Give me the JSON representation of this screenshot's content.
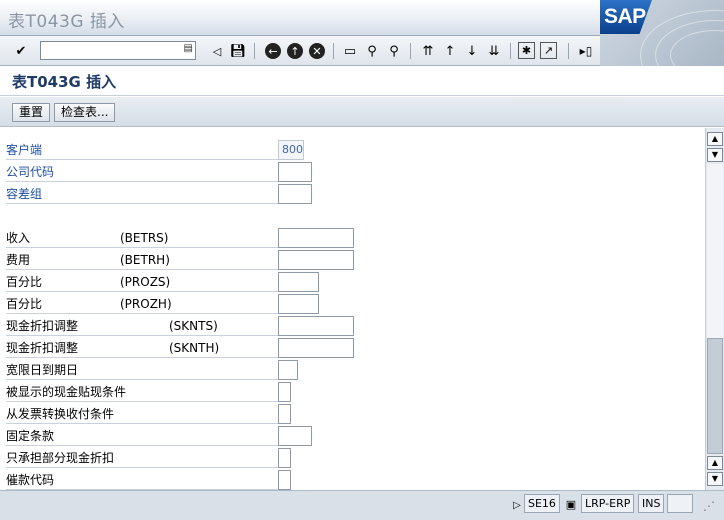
{
  "window": {
    "title": "表T043G 插入"
  },
  "logo_text": "SAP",
  "toolbar": {
    "command_field_value": "",
    "icons": [
      "enter-icon",
      "save-icon",
      "back-icon",
      "exit-icon",
      "cancel-icon",
      "print-icon",
      "find-icon",
      "find-next-icon",
      "first-page-icon",
      "prev-page-icon",
      "next-page-icon",
      "last-page-icon",
      "new-session-icon",
      "shortcut-icon",
      "help-icon"
    ]
  },
  "screen_title": "表T043G 插入",
  "app_toolbar": {
    "buttons": [
      "重置",
      "检查表..."
    ]
  },
  "fields": [
    {
      "label": "客户端",
      "tech": "",
      "value": "800"
    },
    {
      "label": "公司代码",
      "tech": "",
      "value": ""
    },
    {
      "label": "容差组",
      "tech": "",
      "value": ""
    },
    {
      "label": "收入",
      "tech": "(BETRS)",
      "value": ""
    },
    {
      "label": "费用",
      "tech": "(BETRH)",
      "value": ""
    },
    {
      "label": "百分比",
      "tech": "(PROZS)",
      "value": ""
    },
    {
      "label": "百分比",
      "tech": "(PROZH)",
      "value": ""
    },
    {
      "label": "现金折扣调整",
      "tech": "(SKNTS)",
      "value": ""
    },
    {
      "label": "现金折扣调整",
      "tech": "(SKNTH)",
      "value": ""
    },
    {
      "label": "宽限日到期日",
      "tech": "",
      "value": ""
    },
    {
      "label": "被显示的现金贴现条件",
      "tech": "",
      "value": ""
    },
    {
      "label": "从发票转换收付条件",
      "tech": "",
      "value": ""
    },
    {
      "label": "固定条款",
      "tech": "",
      "value": ""
    },
    {
      "label": "只承担部分现金折扣",
      "tech": "",
      "value": ""
    },
    {
      "label": "催款代码",
      "tech": "",
      "value": ""
    }
  ],
  "statusbar": {
    "transaction": "SE16",
    "system": "LRP-ERP",
    "mode": "INS"
  },
  "colors": {
    "label_blue": "#1f4fa0",
    "title_navy": "#1f3b68"
  }
}
